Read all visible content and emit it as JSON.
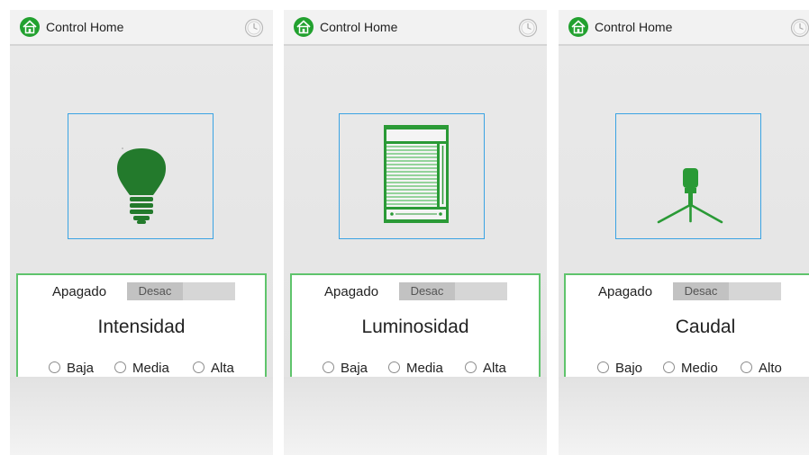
{
  "screens": [
    {
      "app_title": "Control Home",
      "device": "light-bulb",
      "state_label": "Apagado",
      "toggle_label": "Desac",
      "mode_title": "Intensidad",
      "options": [
        "Baja",
        "Media",
        "Alta"
      ],
      "icons": {
        "app": "home-icon",
        "clock": "clock-icon",
        "device": "light-bulb-icon"
      }
    },
    {
      "app_title": "Control Home",
      "device": "window-blind",
      "state_label": "Apagado",
      "toggle_label": "Desac",
      "mode_title": "Luminosidad",
      "options": [
        "Baja",
        "Media",
        "Alta"
      ],
      "icons": {
        "app": "home-icon",
        "clock": "clock-icon",
        "device": "window-blind-icon"
      }
    },
    {
      "app_title": "Control Home",
      "device": "sprinkler",
      "state_label": "Apagado",
      "toggle_label": "Desac",
      "mode_title": "Caudal",
      "options": [
        "Bajo",
        "Medio",
        "Alto"
      ],
      "icons": {
        "app": "home-icon",
        "clock": "clock-icon",
        "device": "sprinkler-icon"
      }
    }
  ],
  "colors": {
    "accent_green": "#22a12f",
    "frame_blue": "#3aa3e3",
    "panel_border": "#5fc46c"
  }
}
